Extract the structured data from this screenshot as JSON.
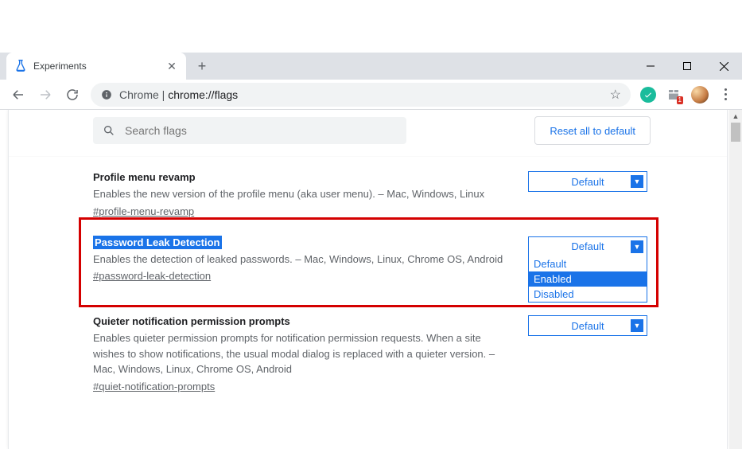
{
  "tab": {
    "title": "Experiments"
  },
  "omnibox": {
    "prefix": "Chrome | ",
    "path": "chrome://flags"
  },
  "ext_badge": "1",
  "search": {
    "placeholder": "Search flags"
  },
  "reset_label": "Reset all to default",
  "select_default_label": "Default",
  "dropdown_options": {
    "default": "Default",
    "enabled": "Enabled",
    "disabled": "Disabled"
  },
  "flags": [
    {
      "title": "Profile menu revamp",
      "desc": "Enables the new version of the profile menu (aka user menu). – Mac, Windows, Linux",
      "anchor": "#profile-menu-revamp"
    },
    {
      "title": "Password Leak Detection",
      "desc": "Enables the detection of leaked passwords. – Mac, Windows, Linux, Chrome OS, Android",
      "anchor": "#password-leak-detection"
    },
    {
      "title": "Quieter notification permission prompts",
      "desc": "Enables quieter permission prompts for notification permission requests. When a site wishes to show notifications, the usual modal dialog is replaced with a quieter version. – Mac, Windows, Linux, Chrome OS, Android",
      "anchor": "#quiet-notification-prompts"
    }
  ]
}
